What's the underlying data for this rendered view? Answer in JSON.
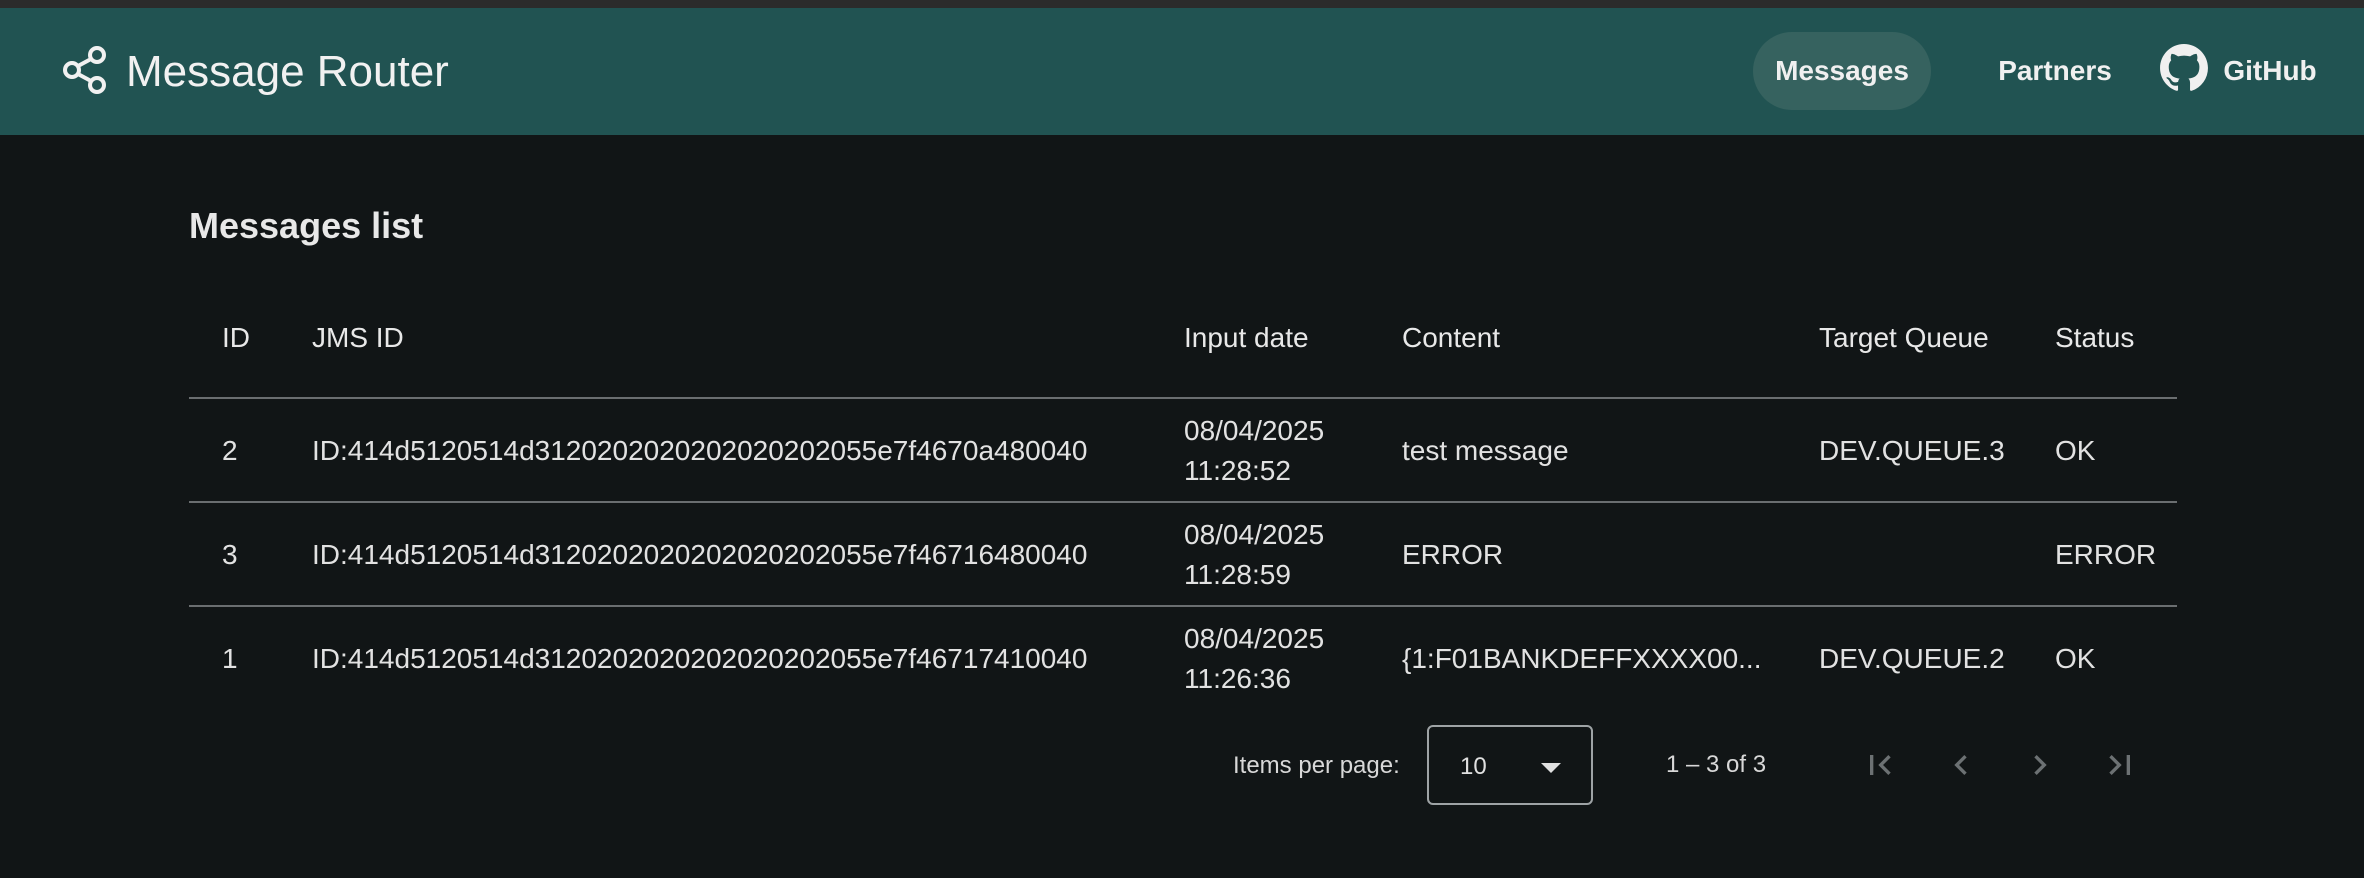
{
  "app": {
    "title": "Message Router"
  },
  "nav": {
    "messages": "Messages",
    "partners": "Partners",
    "github": "GitHub"
  },
  "page": {
    "title": "Messages list"
  },
  "table": {
    "columns": [
      "ID",
      "JMS ID",
      "Input date",
      "Content",
      "Target Queue",
      "Status"
    ],
    "rows": [
      {
        "id": "2",
        "jms_id": "ID:414d5120514d3120202020202020202055e7f4670a480040",
        "date": "08/04/2025",
        "time": "11:28:52",
        "content": "test message",
        "queue": "DEV.QUEUE.3",
        "status": "OK"
      },
      {
        "id": "3",
        "jms_id": "ID:414d5120514d3120202020202020202055e7f46716480040",
        "date": "08/04/2025",
        "time": "11:28:59",
        "content": "ERROR",
        "queue": "",
        "status": "ERROR"
      },
      {
        "id": "1",
        "jms_id": "ID:414d5120514d3120202020202020202055e7f46717410040",
        "date": "08/04/2025",
        "time": "11:26:36",
        "content": "{1:F01BANKDEFFXXXX00...",
        "queue": "DEV.QUEUE.2",
        "status": "OK"
      }
    ]
  },
  "paginator": {
    "label": "Items per page:",
    "page_size": "10",
    "range": "1 – 3 of 3"
  },
  "colors": {
    "navbar": "#215352",
    "active_nav": "#36625f",
    "background": "#111516"
  },
  "icons": {
    "brand": "share-nodes-icon",
    "github": "github-icon"
  }
}
